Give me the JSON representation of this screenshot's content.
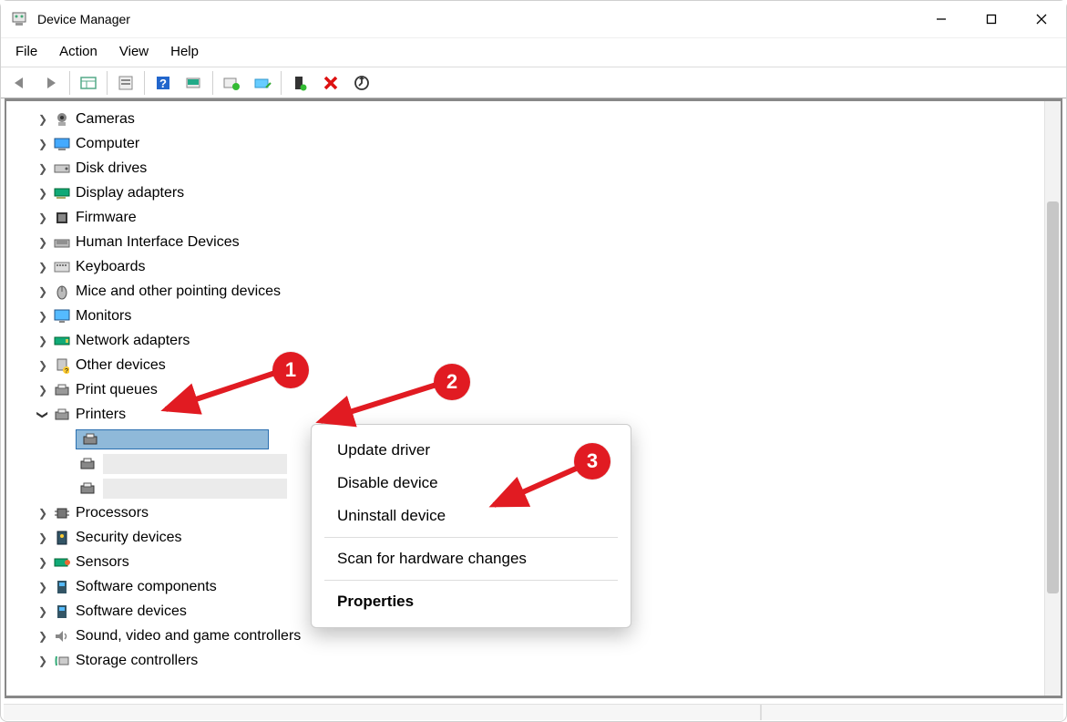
{
  "titlebar": {
    "title": "Device Manager"
  },
  "menubar": {
    "file": "File",
    "action": "Action",
    "view": "View",
    "help": "Help"
  },
  "tree": {
    "items": [
      {
        "label": "Cameras",
        "expanded": false
      },
      {
        "label": "Computer",
        "expanded": false
      },
      {
        "label": "Disk drives",
        "expanded": false
      },
      {
        "label": "Display adapters",
        "expanded": false
      },
      {
        "label": "Firmware",
        "expanded": false
      },
      {
        "label": "Human Interface Devices",
        "expanded": false
      },
      {
        "label": "Keyboards",
        "expanded": false
      },
      {
        "label": "Mice and other pointing devices",
        "expanded": false
      },
      {
        "label": "Monitors",
        "expanded": false
      },
      {
        "label": "Network adapters",
        "expanded": false
      },
      {
        "label": "Other devices",
        "expanded": false
      },
      {
        "label": "Print queues",
        "expanded": false
      },
      {
        "label": "Printers",
        "expanded": true
      },
      {
        "label": "Processors",
        "expanded": false
      },
      {
        "label": "Security devices",
        "expanded": false
      },
      {
        "label": "Sensors",
        "expanded": false
      },
      {
        "label": "Software components",
        "expanded": false
      },
      {
        "label": "Software devices",
        "expanded": false
      },
      {
        "label": "Sound, video and game controllers",
        "expanded": false
      },
      {
        "label": "Storage controllers",
        "expanded": false
      }
    ]
  },
  "context_menu": {
    "update": "Update driver",
    "disable": "Disable device",
    "uninstall": "Uninstall device",
    "scan": "Scan for hardware changes",
    "properties": "Properties"
  },
  "callouts": {
    "one": "1",
    "two": "2",
    "three": "3"
  }
}
